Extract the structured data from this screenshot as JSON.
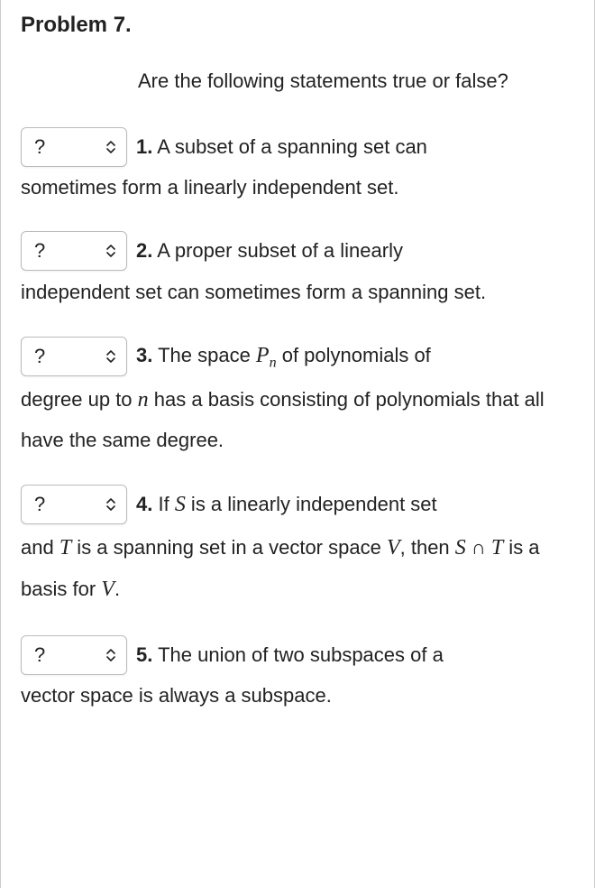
{
  "title": "Problem 7.",
  "intro": "Are the following statements true or false?",
  "select_placeholder": "?",
  "questions": {
    "q1": {
      "num": "1.",
      "first": " A subset of a spanning set can",
      "rest": "sometimes form a linearly independent set."
    },
    "q2": {
      "num": "2.",
      "first": " A proper subset of a linearly",
      "rest": "independent set can sometimes form a spanning set."
    },
    "q3": {
      "num": "3.",
      "first_a": " The space ",
      "var_P": "P",
      "sub_n": "n",
      "first_b": " of polynomials of",
      "rest_a": "degree up to ",
      "var_n": "n",
      "rest_b": " has a basis consisting of polynomials that all have the same degree."
    },
    "q4": {
      "num": "4.",
      "first_a": " If ",
      "var_S": "S",
      "first_b": " is a linearly independent set",
      "rest_a": "and ",
      "var_T": "T",
      "rest_b": " is a spanning set in a vector space ",
      "var_V": "V",
      "rest_c": ", then ",
      "var_S2": "S",
      "intersect": " ∩ ",
      "var_T2": "T",
      "rest_d": " is a basis for ",
      "var_V2": "V",
      "rest_e": "."
    },
    "q5": {
      "num": "5.",
      "first": " The union of two subspaces of a",
      "rest": "vector space is always a subspace."
    }
  }
}
